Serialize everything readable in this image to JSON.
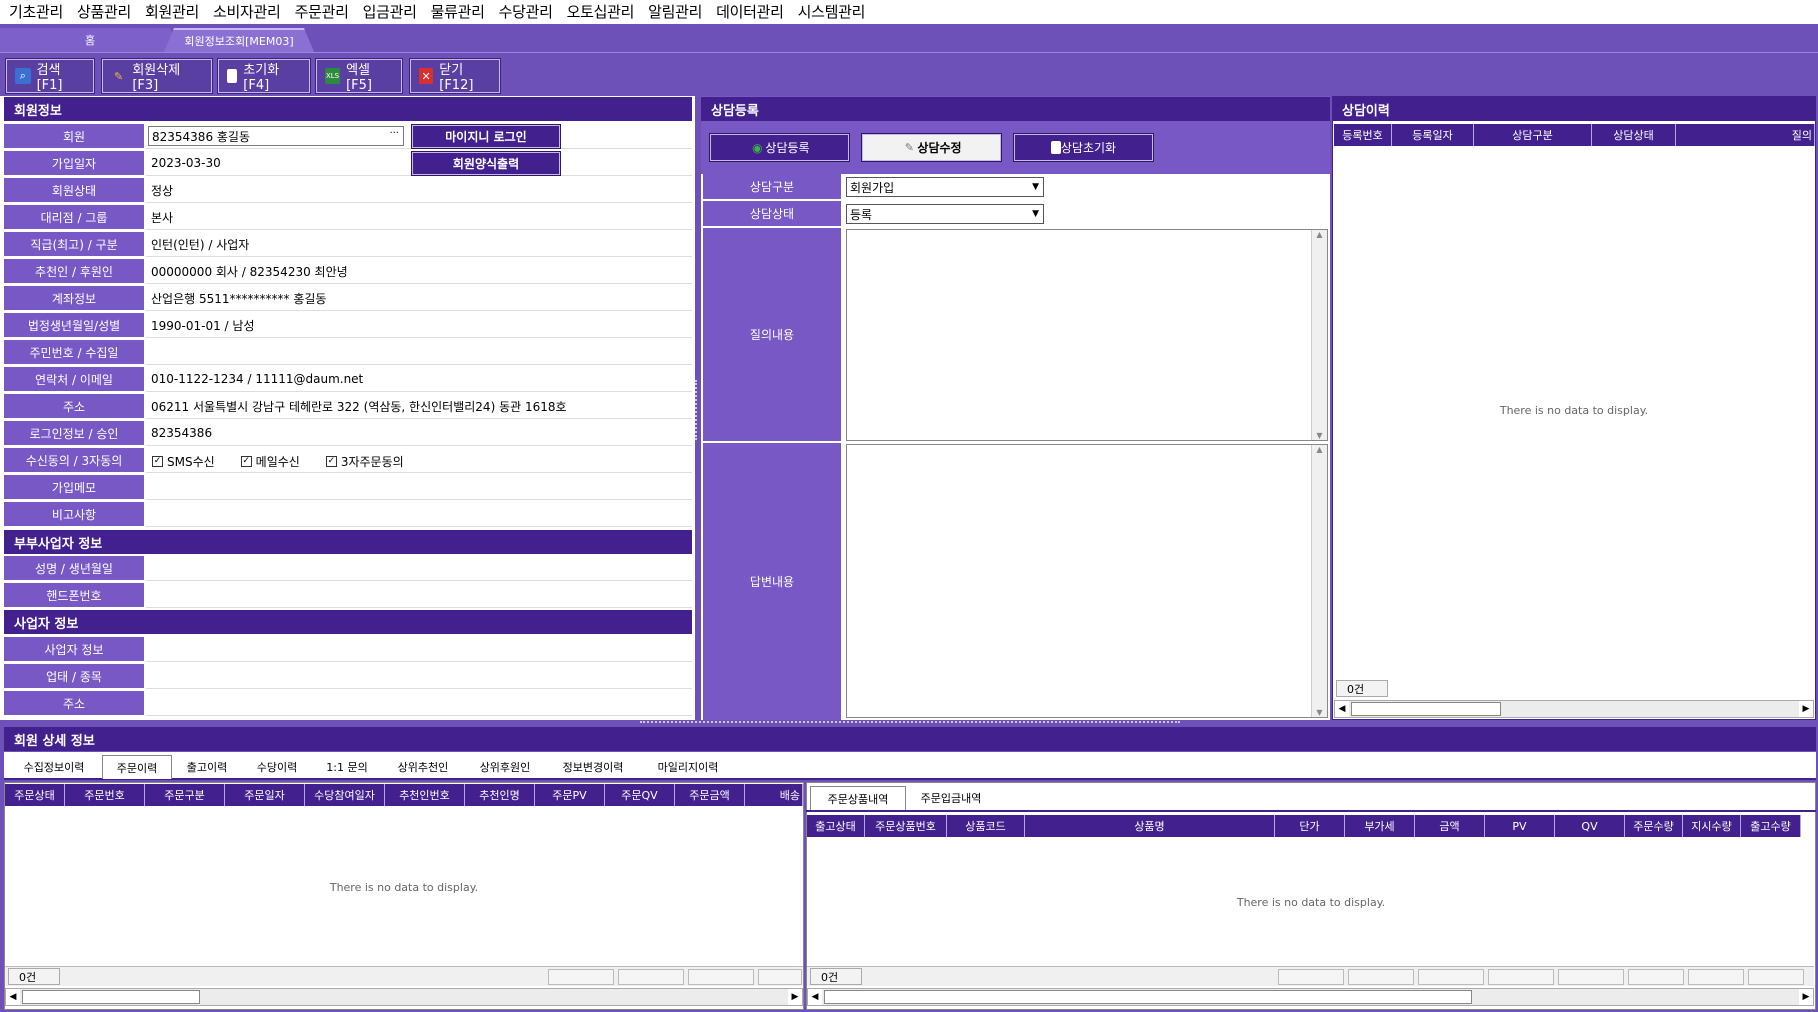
{
  "menu": [
    "기초관리",
    "상품관리",
    "회원관리",
    "소비자관리",
    "주문관리",
    "입금관리",
    "물류관리",
    "수당관리",
    "오토십관리",
    "알림관리",
    "데이터관리",
    "시스템관리"
  ],
  "tabs": {
    "home": "홈",
    "current": "회원정보조회[MEM03]"
  },
  "toolbar": {
    "search": "검색[F1]",
    "delete": "회원삭제[F3]",
    "reset": "초기화[F4]",
    "excel": "엑셀[F5]",
    "close": "닫기[F12]"
  },
  "member": {
    "title": "회원정보",
    "fields": [
      {
        "label": "회원",
        "value": ""
      },
      {
        "label": "가입일자",
        "value": "2023-03-30"
      },
      {
        "label": "회원상태",
        "value": "정상"
      },
      {
        "label": "대리점 / 그룹",
        "value": "본사"
      },
      {
        "label": "직급(최고) / 구분",
        "value": "인턴(인턴) / 사업자"
      },
      {
        "label": "추천인 / 후원인",
        "value": "00000000 회사 / 82354230 최안녕"
      },
      {
        "label": "계좌정보",
        "value": "산업은행   5511**********  홍길동"
      },
      {
        "label": "법정생년월일/성별",
        "value": "1990-01-01 / 남성"
      },
      {
        "label": "주민번호 / 수집일",
        "value": ""
      },
      {
        "label": "연락처 / 이메일",
        "value": "010-1122-1234 / 11111@daum.net"
      },
      {
        "label": "주소",
        "value": "06211 서울특별시 강남구 테헤란로 322 (역삼동, 한신인터밸리24) 동관 1618호"
      },
      {
        "label": "로그인정보 / 승인",
        "value": "82354386"
      },
      {
        "label": "수신동의 / 3자동의",
        "value": ""
      },
      {
        "label": "가입메모",
        "value": ""
      },
      {
        "label": "비고사항",
        "value": ""
      }
    ],
    "member_input": "82354386 홍길동",
    "mygenie_login": "마이지니 로그인",
    "print_form": "회원양식출력",
    "consents": [
      "SMS수신",
      "메일수신",
      "3자주문동의"
    ]
  },
  "spouse": {
    "title": "부부사업자 정보",
    "fields": [
      "성명 / 생년월일",
      "핸드폰번호"
    ]
  },
  "business": {
    "title": "사업자 정보",
    "fields": [
      "사업자 정보",
      "업태 / 종목",
      "주소"
    ]
  },
  "consult": {
    "title": "상담등록",
    "register": "상담등록",
    "modify": "상담수정",
    "reset": "상담초기화",
    "type_label": "상담구분",
    "type_value": "회원가입",
    "status_label": "상담상태",
    "status_value": "등록",
    "question_label": "질의내용",
    "answer_label": "답변내용"
  },
  "history": {
    "title": "상담이력",
    "columns": [
      "등록번호",
      "등록일자",
      "상담구분",
      "상담상태",
      "질의"
    ],
    "empty": "There is no data to display.",
    "count": "0건"
  },
  "detail": {
    "title": "회원 상세 정보",
    "tabs": [
      "수집정보이력",
      "주문이력",
      "출고이력",
      "수당이력",
      "1:1 문의",
      "상위추천인",
      "상위후원인",
      "정보변경이력",
      "마일리지이력"
    ],
    "order_columns": [
      "주문상태",
      "주문번호",
      "주문구분",
      "주문일자",
      "수당참여일자",
      "추천인번호",
      "추천인명",
      "주문PV",
      "주문QV",
      "주문금액",
      "배송"
    ],
    "empty": "There is no data to display.",
    "count": "0건",
    "right_tabs": [
      "주문상품내역",
      "주문입금내역"
    ],
    "product_columns": [
      "출고상태",
      "주문상품번호",
      "상품코드",
      "상품명",
      "단가",
      "부가세",
      "금액",
      "PV",
      "QV",
      "주문수량",
      "지시수량",
      "출고수량"
    ],
    "right_empty": "There is no data to display.",
    "right_count": "0건"
  }
}
